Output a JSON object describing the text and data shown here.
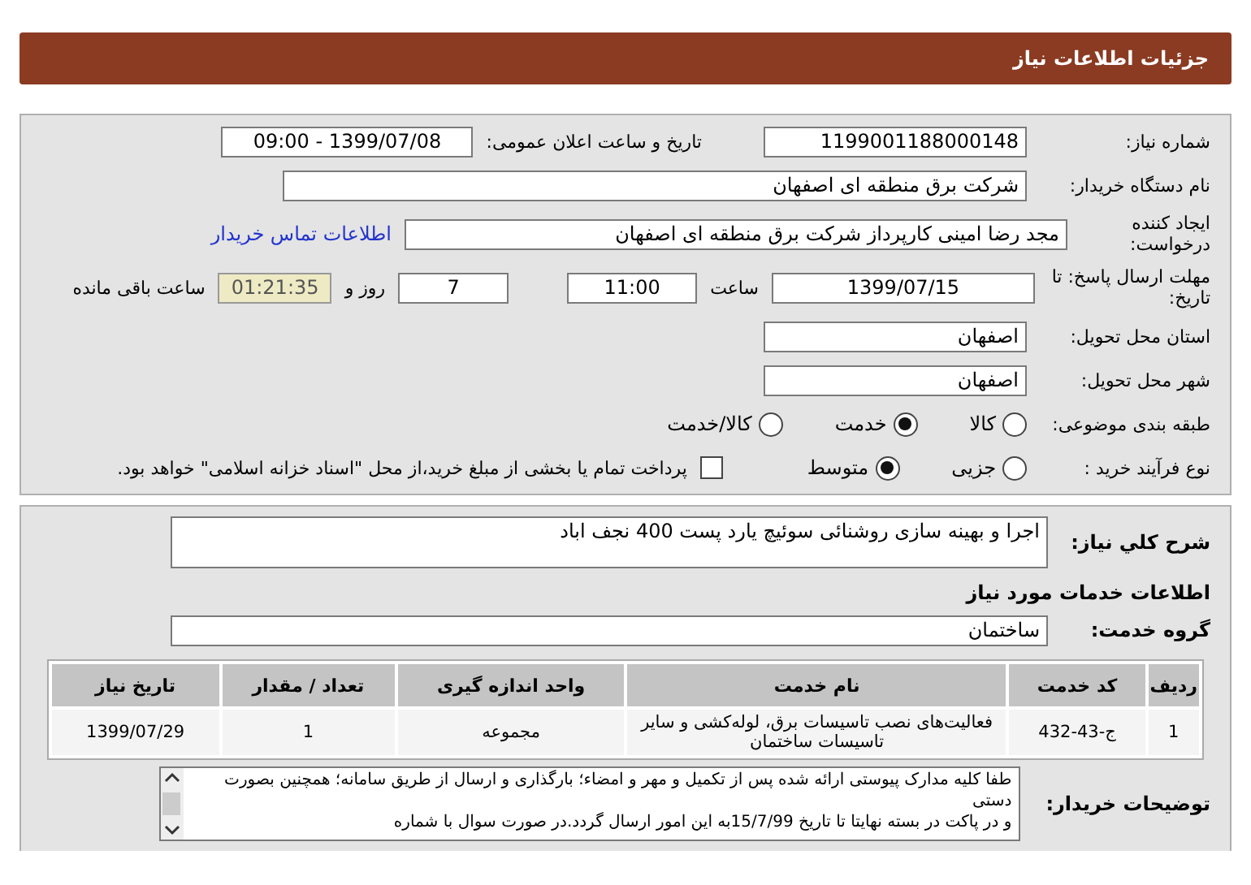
{
  "header": {
    "title": "جزئیات اطلاعات نیاز"
  },
  "need_number": {
    "label": "شماره نیاز:",
    "value": "1199001188000148"
  },
  "announce": {
    "label": "تاریخ و ساعت اعلان عمومی:",
    "value": "1399/07/08 - 09:00"
  },
  "buyer": {
    "label": "نام دستگاه خریدار:",
    "value": "شرکت برق منطقه ای اصفهان"
  },
  "requester": {
    "label": "ایجاد کننده درخواست:",
    "value": "مجد رضا امینی کارپرداز شرکت برق منطقه ای اصفهان",
    "contact_link": "اطلاعات تماس خریدار"
  },
  "deadline": {
    "label": "مهلت ارسال پاسخ: تا تاریخ:",
    "date": "1399/07/15",
    "time_label": "ساعت",
    "time": "11:00",
    "days": "7",
    "days_label": "روز و",
    "remaining": "01:21:35",
    "remaining_label": "ساعت باقی مانده"
  },
  "province": {
    "label": "استان محل تحویل:",
    "value": "اصفهان"
  },
  "city": {
    "label": "شهر محل تحویل:",
    "value": "اصفهان"
  },
  "category": {
    "label": "طبقه بندی موضوعی:",
    "options": [
      {
        "label": "کالا",
        "selected": false
      },
      {
        "label": "خدمت",
        "selected": true
      },
      {
        "label": "کالا/خدمت",
        "selected": false
      }
    ]
  },
  "process": {
    "label": "نوع فرآیند خرید :",
    "options": [
      {
        "label": "جزیی",
        "selected": false
      },
      {
        "label": "متوسط",
        "selected": true
      }
    ],
    "payment_checkbox": {
      "label": "پرداخت تمام یا بخشی از مبلغ خرید،از محل \"اسناد خزانه اسلامی\" خواهد بود.",
      "checked": false
    }
  },
  "summary": {
    "label": "شرح کلي نیاز:",
    "value": "اجرا و بهینه سازی روشنائی سوئیچ یارد پست 400 نجف اباد"
  },
  "services_heading": "اطلاعات خدمات مورد نیاز",
  "service_group": {
    "label": "گروه خدمت:",
    "value": "ساختمان"
  },
  "table": {
    "columns": [
      "ردیف",
      "کد خدمت",
      "نام خدمت",
      "واحد اندازه گیری",
      "تعداد / مقدار",
      "تاریخ نیاز"
    ],
    "rows": [
      [
        "1",
        "ج-43-432",
        "فعالیت‌های نصب تاسیسات برق، لوله‌کشی و سایر تاسیسات ساختمان",
        "مجموعه",
        "1",
        "1399/07/29"
      ]
    ]
  },
  "buyer_notes": {
    "label": "توضیحات خریدار:",
    "lines": [
      "طفا کلیه مدارک پیوستی ارائه شده  پس از تکمیل و مهر و امضاء؛ بارگذاری و ارسال از طریق سامانه؛ همچنین بصورت دستی",
      "و در پاکت در بسته نهایتا تا تاریخ 15/7/99به این امور ارسال گردد.در صورت سوال با شماره"
    ]
  }
}
